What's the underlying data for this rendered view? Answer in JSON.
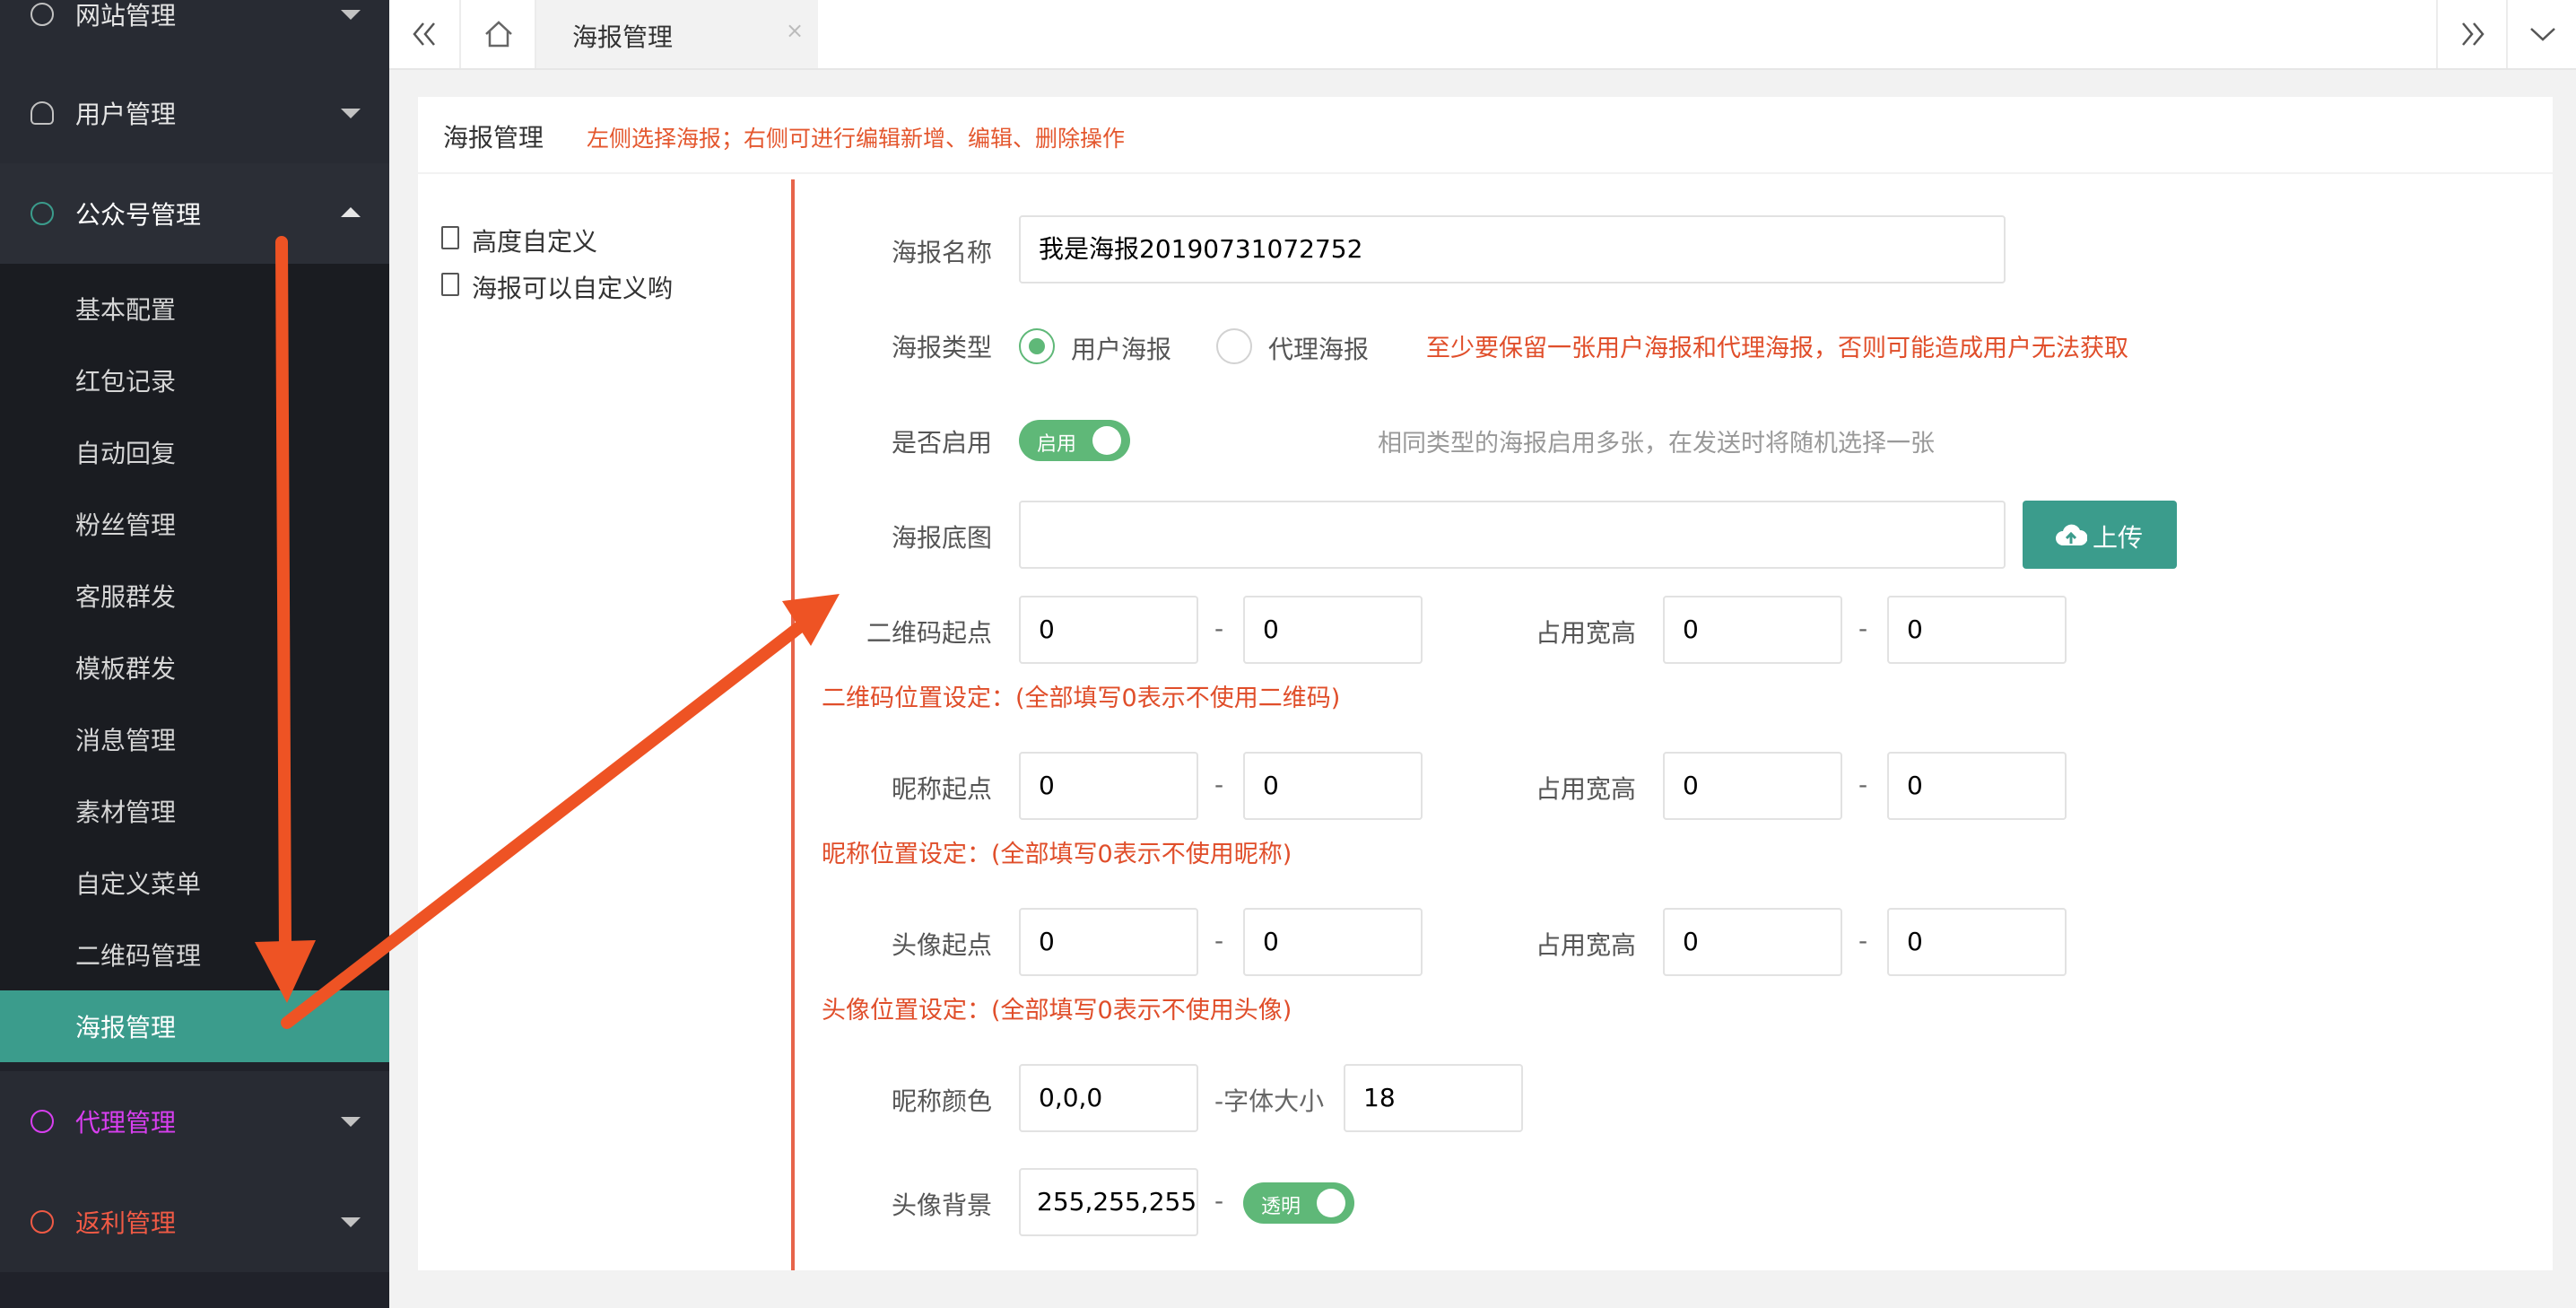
{
  "sidebar": {
    "groups": [
      {
        "label": "网站管理",
        "icon": "globe-icon"
      },
      {
        "label": "用户管理",
        "icon": "user-icon"
      },
      {
        "label": "公众号管理",
        "icon": "wechat-icon"
      },
      {
        "label": "代理管理",
        "icon": "agent-icon"
      },
      {
        "label": "返利管理",
        "icon": "rebate-icon"
      }
    ],
    "items": [
      "基本配置",
      "红包记录",
      "自动回复",
      "粉丝管理",
      "客服群发",
      "模板群发",
      "消息管理",
      "素材管理",
      "自定义菜单",
      "二维码管理",
      "海报管理"
    ],
    "colors": {
      "active": "#3b9c8c",
      "agent": "#d83ff0",
      "rebate": "#f05a45"
    }
  },
  "topbar": {
    "tab_label": "海报管理",
    "tab_close": "×"
  },
  "card": {
    "title": "海报管理",
    "hint": "左侧选择海报；右侧可进行编辑新增、编辑、删除操作"
  },
  "tree": [
    "高度自定义",
    "海报可以自定义哟"
  ],
  "form": {
    "name_label": "海报名称",
    "name_value": "我是海报20190731072752",
    "type_label": "海报类型",
    "type_user": "用户海报",
    "type_agent": "代理海报",
    "type_note": "至少要保留一张用户海报和代理海报，否则可能造成用户无法获取",
    "enable_label": "是否启用",
    "enable_switch": "启用",
    "enable_note": "相同类型的海报启用多张，在发送时将随机选择一张",
    "bg_label": "海报底图",
    "upload_label": "上传",
    "dash": "-",
    "size_label": "占用宽高",
    "qr_label": "二维码起点",
    "qr_note": "二维码位置设定：(全部填写0表示不使用二维码)",
    "nick_label": "昵称起点",
    "nick_note": "昵称位置设定：(全部填写0表示不使用昵称)",
    "avatar_label": "头像起点",
    "avatar_note": "头像位置设定：(全部填写0表示不使用头像)",
    "zero": "0",
    "color_label": "昵称颜色",
    "color_value": "0,0,0",
    "font_label": "-字体大小",
    "font_value": "18",
    "avatar_bg_label": "头像背景",
    "avatar_bg_value": "255,255,255",
    "transparent_switch": "透明"
  }
}
